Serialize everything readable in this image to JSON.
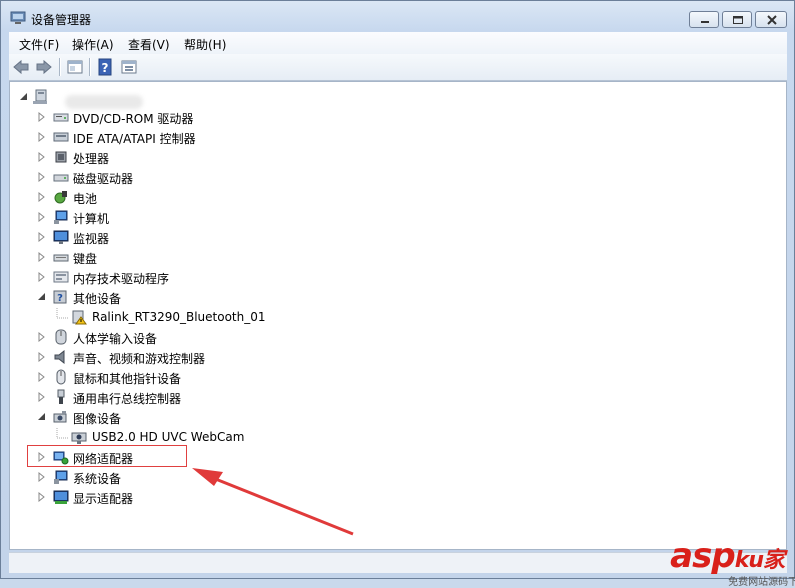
{
  "window": {
    "title": "设备管理器"
  },
  "menu": [
    {
      "label": "文件(F)"
    },
    {
      "label": "操作(A)"
    },
    {
      "label": "查看(V)"
    },
    {
      "label": "帮助(H)"
    }
  ],
  "toolbar": {
    "icons": [
      "back-icon",
      "forward-icon",
      "properties-icon",
      "help-icon",
      "show-hidden-icon"
    ]
  },
  "tree": {
    "root_label": "",
    "items": [
      {
        "label": "DVD/CD-ROM 驱动器",
        "icon": "dvd-drive-icon",
        "expanded": false
      },
      {
        "label": "IDE ATA/ATAPI 控制器",
        "icon": "ide-controller-icon",
        "expanded": false
      },
      {
        "label": "处理器",
        "icon": "processor-icon",
        "expanded": false
      },
      {
        "label": "磁盘驱动器",
        "icon": "disk-drive-icon",
        "expanded": false
      },
      {
        "label": "电池",
        "icon": "battery-icon",
        "expanded": false
      },
      {
        "label": "计算机",
        "icon": "computer-icon",
        "expanded": false
      },
      {
        "label": "监视器",
        "icon": "monitor-icon",
        "expanded": false
      },
      {
        "label": "键盘",
        "icon": "keyboard-icon",
        "expanded": false
      },
      {
        "label": "内存技术驱动程序",
        "icon": "memory-driver-icon",
        "expanded": false
      },
      {
        "label": "其他设备",
        "icon": "other-devices-icon",
        "expanded": true,
        "children": [
          {
            "label": "Ralink_RT3290_Bluetooth_01",
            "icon": "unknown-device-warning-icon"
          }
        ]
      },
      {
        "label": "人体学输入设备",
        "icon": "hid-icon",
        "expanded": false
      },
      {
        "label": "声音、视频和游戏控制器",
        "icon": "speaker-icon",
        "expanded": false
      },
      {
        "label": "鼠标和其他指针设备",
        "icon": "mouse-icon",
        "expanded": false
      },
      {
        "label": "通用串行总线控制器",
        "icon": "usb-icon",
        "expanded": false
      },
      {
        "label": "图像设备",
        "icon": "camera-icon",
        "expanded": true,
        "children": [
          {
            "label": "USB2.0 HD UVC WebCam",
            "icon": "webcam-icon"
          }
        ]
      },
      {
        "label": "网络适配器",
        "icon": "network-adapter-icon",
        "expanded": false
      },
      {
        "label": "系统设备",
        "icon": "system-device-icon",
        "expanded": false
      },
      {
        "label": "显示适配器",
        "icon": "display-adapter-icon",
        "expanded": false
      }
    ]
  },
  "annotation": {
    "highlight_color": "#e04040",
    "arrow_color": "#e03a3a"
  },
  "watermark": {
    "brand": "asp",
    "brand_tail": "ku",
    "suffix": "家",
    "subtitle": "免费网站源码下载站"
  }
}
